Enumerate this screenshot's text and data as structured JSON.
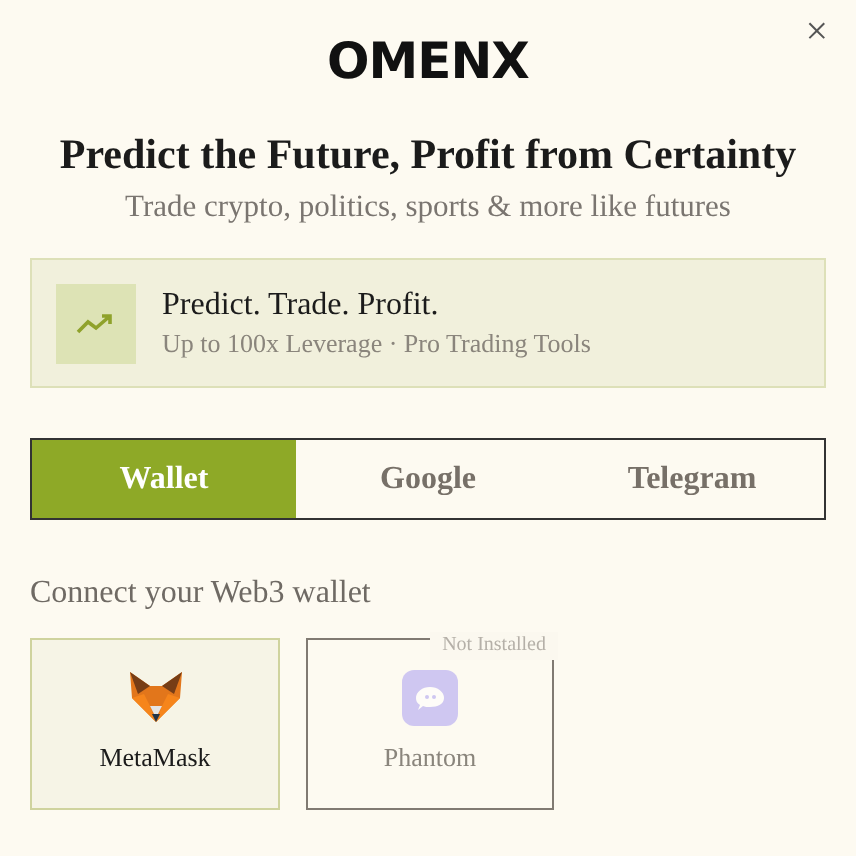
{
  "logo": "OMENX",
  "close": "×",
  "headline": "Predict the Future, Profit from Certainty",
  "subtitle": "Trade crypto, politics, sports & more like futures",
  "banner": {
    "title": "Predict. Trade. Profit.",
    "subtitle": "Up to 100x Leverage · Pro Trading Tools"
  },
  "tabs": [
    {
      "label": "Wallet",
      "selected": true
    },
    {
      "label": "Google",
      "selected": false
    },
    {
      "label": "Telegram",
      "selected": false
    }
  ],
  "section_label": "Connect your Web3 wallet",
  "wallets": [
    {
      "kind": "fox",
      "name": "MetaMask",
      "installed": true
    },
    {
      "kind": "ghost",
      "name": "Phantom",
      "installed": false,
      "badge": "Not Installed"
    }
  ]
}
